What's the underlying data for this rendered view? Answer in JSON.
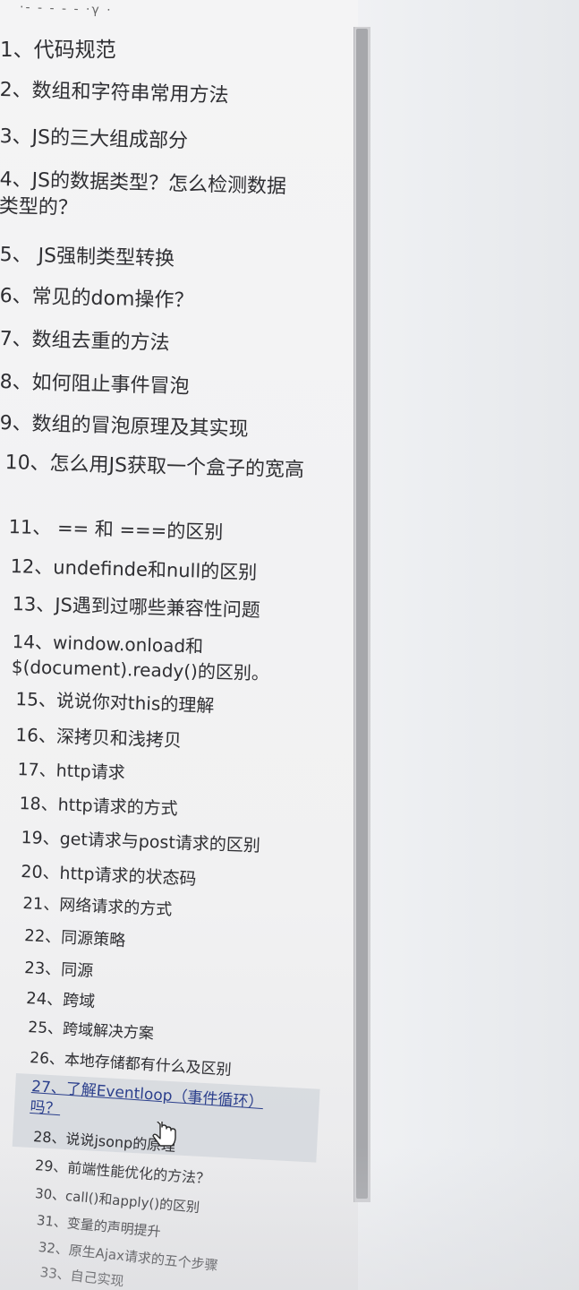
{
  "header": {
    "top_cut_text": "·- - - - - ·γ ·"
  },
  "toc": {
    "items": [
      {
        "label": "1、代码规范"
      },
      {
        "label": "2、数组和字符串常用方法"
      },
      {
        "label": "3、JS的三大组成部分"
      },
      {
        "label": "4、JS的数据类型？怎么检测数据类型的？"
      },
      {
        "label": "5、 JS强制类型转换"
      },
      {
        "label": "6、常见的dom操作？"
      },
      {
        "label": "7、数组去重的方法"
      },
      {
        "label": "8、如何阻止事件冒泡"
      },
      {
        "label": "9、数组的冒泡原理及其实现"
      },
      {
        "label": "10、怎么用JS获取一个盒子的宽高"
      },
      {
        "label": "11、 == 和 ===的区别"
      },
      {
        "label": "12、undefinde和null的区别"
      },
      {
        "label": "13、JS遇到过哪些兼容性问题"
      },
      {
        "label": "14、window.onload和$(document).ready()的区别。"
      },
      {
        "label": "15、说说你对this的理解"
      },
      {
        "label": "16、深拷贝和浅拷贝"
      },
      {
        "label": "17、http请求"
      },
      {
        "label": "18、http请求的方式"
      },
      {
        "label": "19、get请求与post请求的区别"
      },
      {
        "label": "20、http请求的状态码"
      },
      {
        "label": "21、网络请求的方式"
      },
      {
        "label": "22、同源策略"
      },
      {
        "label": "23、同源"
      },
      {
        "label": "24、跨域"
      },
      {
        "label": "25、跨域解决方案"
      },
      {
        "label": "26、本地存储都有什么及区别"
      },
      {
        "label": "27、了解Eventloop（事件循环）吗？"
      },
      {
        "label": "28、说说jsonp的原理"
      },
      {
        "label": "29、前端性能优化的方法？"
      },
      {
        "label": "30、call()和apply()的区别"
      },
      {
        "label": "31、变量的声明提升"
      },
      {
        "label": "32、原生Ajax请求的五个步骤"
      },
      {
        "label": "33、自己实现"
      }
    ]
  },
  "colors": {
    "text": "#2f2f33",
    "link": "#2b3f8c",
    "background": "#f1f1f2",
    "scrollbar": "#a6a7ab"
  },
  "icons": {
    "cursor": "hand-pointer-icon"
  }
}
